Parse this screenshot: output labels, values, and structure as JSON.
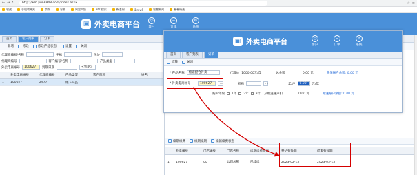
{
  "browser": {
    "url": "http://wm.yun8848.com/Index.aspx",
    "bookmarks": [
      "收藏",
      "手机收藏夹",
      "京东",
      "谷歌",
      "阿里大鱼",
      "360搜索",
      "新浪网",
      "iBrowF",
      "智慧新闻",
      "卷卷精选"
    ]
  },
  "app": {
    "title": "外卖电商平台",
    "menu": [
      {
        "label": "客户",
        "icon": "user-icon"
      },
      {
        "label": "订单",
        "icon": "order-icon"
      },
      {
        "label": "系统",
        "icon": "gear-icon"
      }
    ]
  },
  "tabs": [
    "首页",
    "客户列表",
    "订单"
  ],
  "toolbar": {
    "buttons": [
      "新增",
      "修改",
      "修改产品状态",
      "设置",
      "关闭"
    ]
  },
  "filters": {
    "row1": {
      "label_a": "代理商编号/名称",
      "label_b": "手机",
      "label_c": "住址",
      "label_d": "省份",
      "label_e": "城市"
    },
    "row2": {
      "label_a": "代理商编号",
      "label_b": "客户编号/名称",
      "label_c": "产品类型"
    },
    "row3": {
      "label_a": "外卖电商帐号",
      "value_a": "100627",
      "label_b": "到期日期",
      "value_b": "",
      "label_c": "选项",
      "value_c": "<到期>"
    }
  },
  "grid": {
    "headers": [
      "",
      "外卖电商帐号",
      "代理商编号",
      "产品类型",
      "客户简称",
      "",
      "姓名"
    ],
    "rows": [
      [
        "1",
        "100627",
        "2977",
        "线下产品",
        "",
        "",
        ""
      ]
    ]
  },
  "popup": {
    "title": "外卖电商平台",
    "tabs": [
      "首页",
      "客户列表",
      "订单"
    ],
    "toolbar": [
      "结算",
      "关闭"
    ],
    "product_name_label": "* 产品名称",
    "product_name_value": "极速配合外卖",
    "agent_price_label": "代理价",
    "agent_price_value": "1000.00元/年",
    "total_label": "总金额",
    "total_value": "0.00 元",
    "balance_link": "充值账户余额: 0.00 元",
    "account_label": "* 外卖电商帐号",
    "account_value": "100627",
    "org_label": "机构",
    "years_label": "年/户",
    "years_value": "0.00",
    "years_unit": "元/年",
    "years_buy_label": "购买年限",
    "years_options": [
      "1年",
      "2年",
      "3年"
    ],
    "from_balance_label": "从赠送账户扣",
    "from_balance_value": "0.00 元",
    "gift_link": "赠送账户余额: 0.00 元"
  },
  "lower": {
    "toolbar": [
      "续期续费",
      "续期续期",
      "续新续费状态"
    ],
    "headers": [
      "",
      "外卖编号",
      "门店编号",
      "门店名称",
      "续期续费状态",
      "开始有效期",
      "结束有效期"
    ],
    "rows": [
      [
        "1",
        "100627",
        "00",
        "公司总部",
        "已续续",
        "2023-02-13",
        "2023-03-13"
      ]
    ]
  },
  "colors": {
    "header": "#4a90d9",
    "highlight": "#d40000"
  }
}
